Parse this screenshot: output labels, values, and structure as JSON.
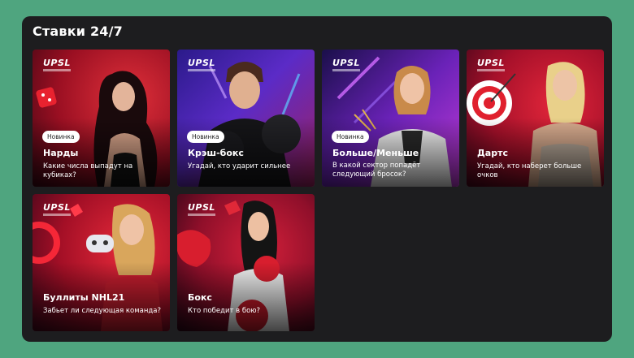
{
  "section": {
    "title": "Ставки 24/7"
  },
  "cards": [
    {
      "badge": "Новинка",
      "name": "Нарды",
      "desc": "Какие числа выпадут на кубиках?",
      "logo": "UPSL"
    },
    {
      "badge": "Новинка",
      "name": "Крэш-бокс",
      "desc": "Угадай, кто ударит сильнее",
      "logo": "UPSL"
    },
    {
      "badge": "Новинка",
      "name": "Больше/Меньше",
      "desc": "В какой сектор попадёт следующий бросок?",
      "logo": "UPSL"
    },
    {
      "badge": "",
      "name": "Дартс",
      "desc": "Угадай, кто наберет больше очков",
      "logo": "UPSL"
    },
    {
      "badge": "",
      "name": "Буллиты NHL21",
      "desc": "Забьет ли следующая команда?",
      "logo": "UPSL"
    },
    {
      "badge": "",
      "name": "Бокс",
      "desc": "Кто победит в бою?",
      "logo": "UPSL"
    }
  ],
  "colors": {
    "page_bg": "#4fa57f",
    "panel_bg": "#1d1d1f",
    "card_red": "#c8102e",
    "card_purple": "#4b1d8c"
  }
}
